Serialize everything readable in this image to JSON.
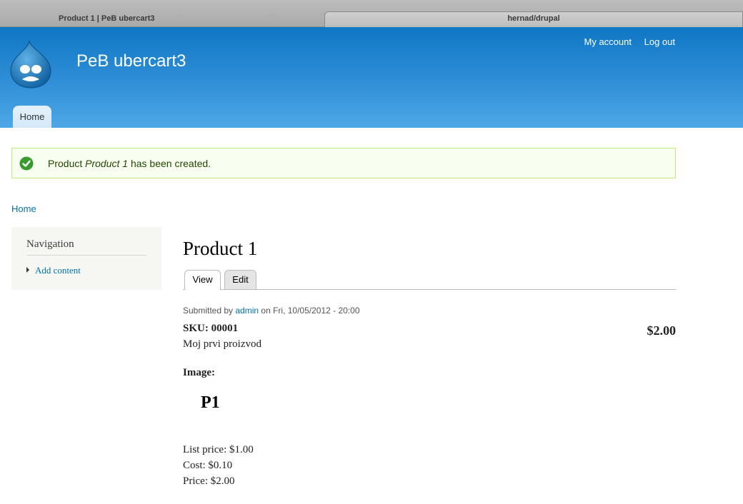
{
  "browser": {
    "tabs": [
      {
        "label": "Product 1 | PeB ubercart3"
      },
      {
        "label": "hernad/drupal"
      }
    ]
  },
  "header": {
    "site_name": "PeB ubercart3",
    "user_menu": {
      "account": "My account",
      "logout": "Log out"
    },
    "main_menu": {
      "home": "Home"
    },
    "logo_icon": "drupal-drop-icon"
  },
  "status": {
    "icon": "check-circle-icon",
    "prefix": "Product ",
    "title": "Product 1",
    "suffix": " has been created."
  },
  "breadcrumb": {
    "home": "Home"
  },
  "sidebar": {
    "title": "Navigation",
    "items": [
      {
        "label": "Add content"
      }
    ]
  },
  "node": {
    "title": "Product 1",
    "tabs": [
      {
        "label": "View"
      },
      {
        "label": "Edit"
      }
    ],
    "submitted_prefix": "Submitted by ",
    "author": "admin",
    "submitted_suffix": " on Fri, 10/05/2012 - 20:00",
    "sku": "SKU: 00001",
    "display_price": "$2.00",
    "description": "Moj prvi proizvod",
    "image_label": "Image:",
    "image_alt": "P1",
    "list_price": "List price: $1.00",
    "cost": "Cost: $0.10",
    "price": "Price: $2.00"
  },
  "colors": {
    "header_top": "#0f77c4",
    "header_bottom": "#4ea7e6",
    "link": "#0071b3",
    "status_bg": "#f8fff0",
    "status_border": "#bbee77"
  }
}
